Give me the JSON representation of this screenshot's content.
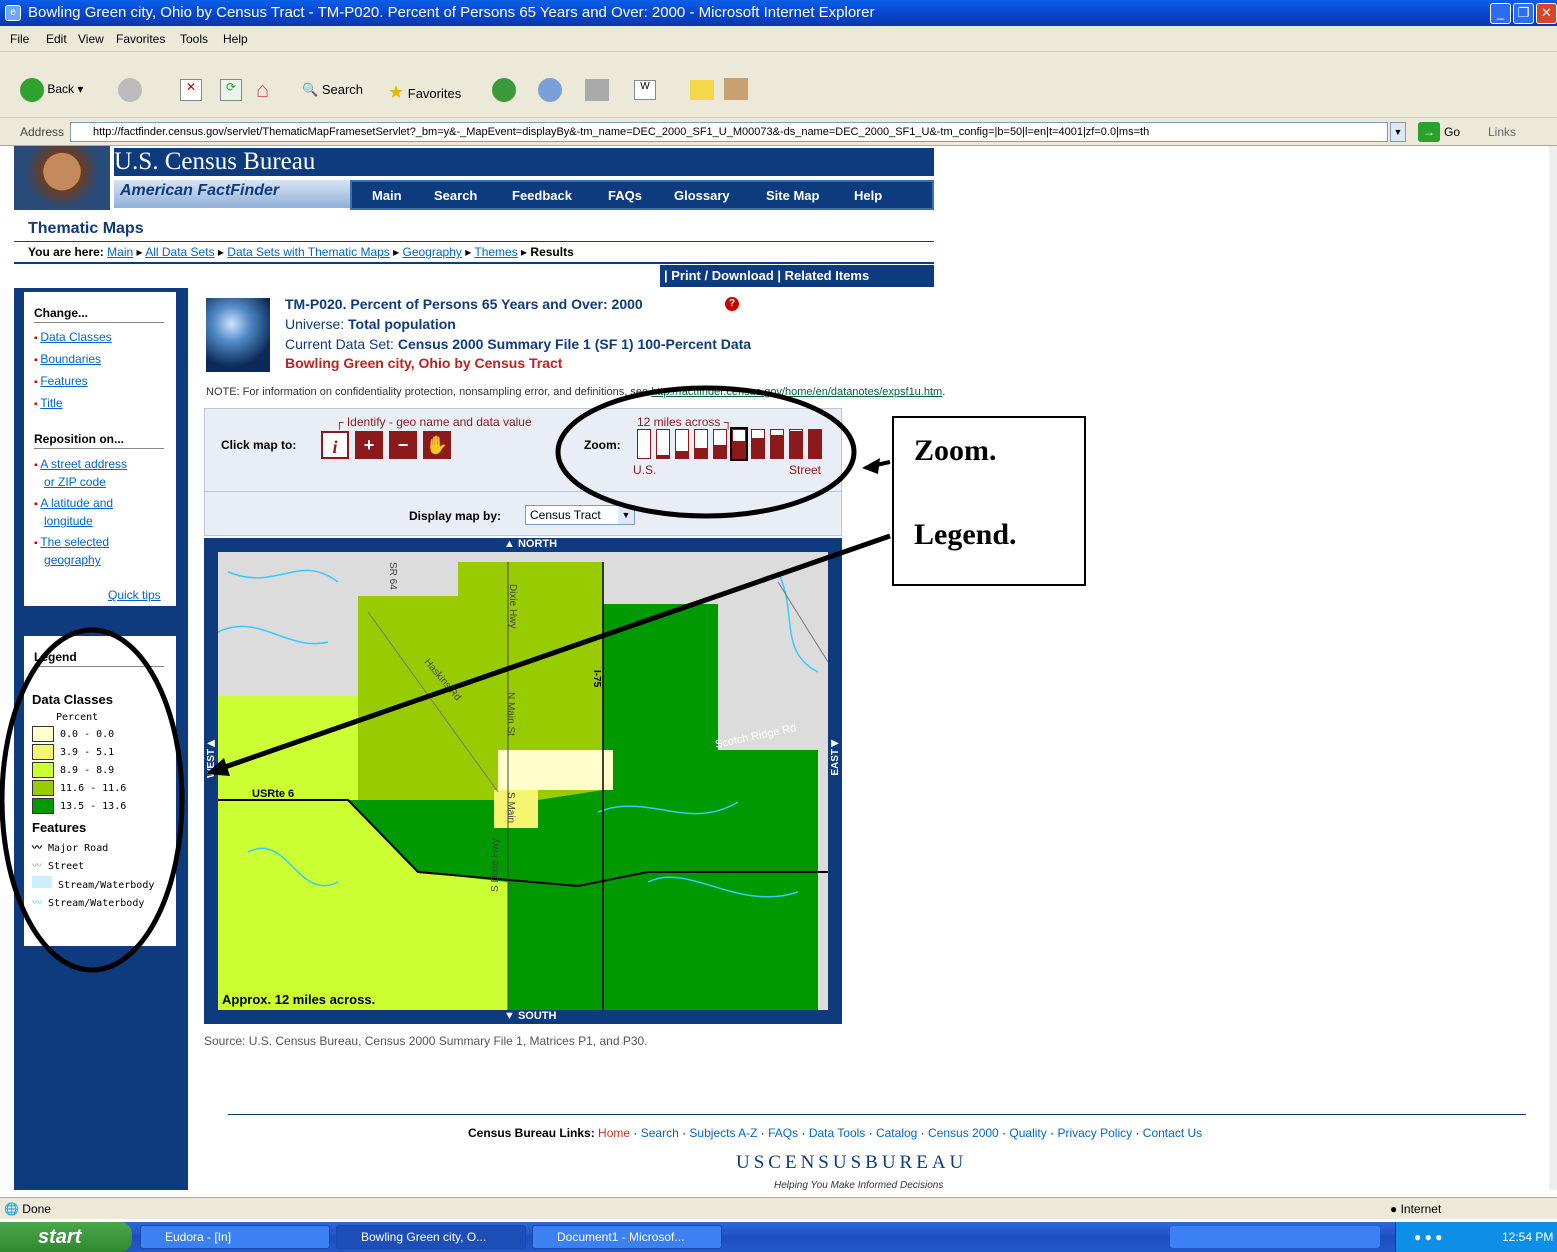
{
  "window": {
    "title": "Bowling Green city, Ohio by Census Tract - TM-P020. Percent of Persons 65 Years and Over: 2000 - Microsoft Internet Explorer"
  },
  "menu": [
    "File",
    "Edit",
    "View",
    "Favorites",
    "Tools",
    "Help"
  ],
  "toolbar": {
    "back": "Back",
    "search": "Search",
    "favorites": "Favorites"
  },
  "address": {
    "label": "Address",
    "url": "http://factfinder.census.gov/servlet/ThematicMapFramesetServlet?_bm=y&-_MapEvent=displayBy&-tm_name=DEC_2000_SF1_U_M00073&-ds_name=DEC_2000_SF1_U&-tm_config=|b=50|l=en|t=4001|zf=0.0|ms=th",
    "go": "Go",
    "links": "Links"
  },
  "header": {
    "bureau": "U.S. Census Bureau",
    "aff": "American FactFinder",
    "nav": [
      "Main",
      "Search",
      "Feedback",
      "FAQs",
      "Glossary",
      "Site Map",
      "Help"
    ]
  },
  "section_title": "Thematic Maps",
  "breadcrumb": {
    "label": "You are here:",
    "items": [
      "Main",
      "All Data Sets",
      "Data Sets with Thematic Maps",
      "Geography",
      "Themes"
    ],
    "current": "Results"
  },
  "print_bar": "| Print / Download  |  Related Items",
  "sidebar": {
    "change_head": "Change...",
    "change_links": [
      "Data Classes",
      "Boundaries",
      "Features",
      "Title"
    ],
    "reposition_head": "Reposition on...",
    "reposition_links": [
      [
        "A street address",
        "or ZIP code"
      ],
      [
        "A latitude and",
        "longitude"
      ],
      [
        "The selected",
        "geography"
      ]
    ],
    "quick_tips": "Quick tips"
  },
  "legend": {
    "title": "Legend",
    "data_classes": "Data Classes",
    "unit": "Percent",
    "classes": [
      {
        "range": "0.0 - 0.0",
        "color": "#ffffcc"
      },
      {
        "range": "3.9 - 5.1",
        "color": "#f5f571"
      },
      {
        "range": "8.9 - 8.9",
        "color": "#ccff33"
      },
      {
        "range": "11.6 - 11.6",
        "color": "#99cc00"
      },
      {
        "range": "13.5 - 13.6",
        "color": "#009900"
      }
    ],
    "features_head": "Features",
    "features": [
      "Major Road",
      "Street",
      "Stream/Waterbody",
      "Stream/Waterbody"
    ]
  },
  "map_info": {
    "title": "TM-P020. Percent of Persons 65 Years and Over: 2000",
    "universe_label": "Universe:",
    "universe": "Total population",
    "dataset_label": "Current Data Set:",
    "dataset": "Census 2000 Summary File 1 (SF 1) 100-Percent Data",
    "geo": "Bowling Green city, Ohio by Census Tract",
    "note_prefix": "NOTE: For information on confidentiality protection, nonsampling error, and definitions, see ",
    "note_link": "http://factfinder.census.gov/home/en/datanotes/expsf1u.htm",
    "note_suffix": "."
  },
  "controls": {
    "identify": "Identify - geo name and data value",
    "click_map": "Click map to:",
    "miles": "12 miles across",
    "zoom": "Zoom:",
    "zoom_us": "U.S.",
    "zoom_street": "Street",
    "zoom_level": 6,
    "zoom_total": 10,
    "display_by": "Display map by:",
    "display_value": "Census Tract"
  },
  "map": {
    "north": "NORTH",
    "south": "SOUTH",
    "east": "EAST",
    "west": "WEST",
    "scale": "Approx. 12 miles across.",
    "roads": [
      "SR 64",
      "Dixie Hwy",
      "I-75",
      "Haskins Rd",
      "N Main St",
      "S Main",
      "Scotch Ridge Rd",
      "USRte 6",
      "S Dixie Hwy"
    ]
  },
  "source": "Source: U.S. Census Bureau, Census 2000 Summary File 1, Matrices P1, and P30.",
  "footer": {
    "label": "Census Bureau Links:",
    "links": [
      "Home",
      "Search",
      "Subjects A-Z",
      "FAQs",
      "Data Tools",
      "Catalog",
      "Census 2000",
      "Quality",
      "Privacy Policy",
      "Contact Us"
    ],
    "logo": "USCENSUSBUREAU",
    "tagline": "Helping You Make Informed Decisions"
  },
  "callouts": {
    "zoom": "Zoom.",
    "legend": "Legend."
  },
  "status": {
    "left": "Done",
    "zone": "Internet"
  },
  "taskbar": {
    "start": "start",
    "items": [
      "Eudora - [In]",
      "Bowling Green city, O...",
      "Document1 - Microsof..."
    ],
    "time": "12:54 PM"
  }
}
